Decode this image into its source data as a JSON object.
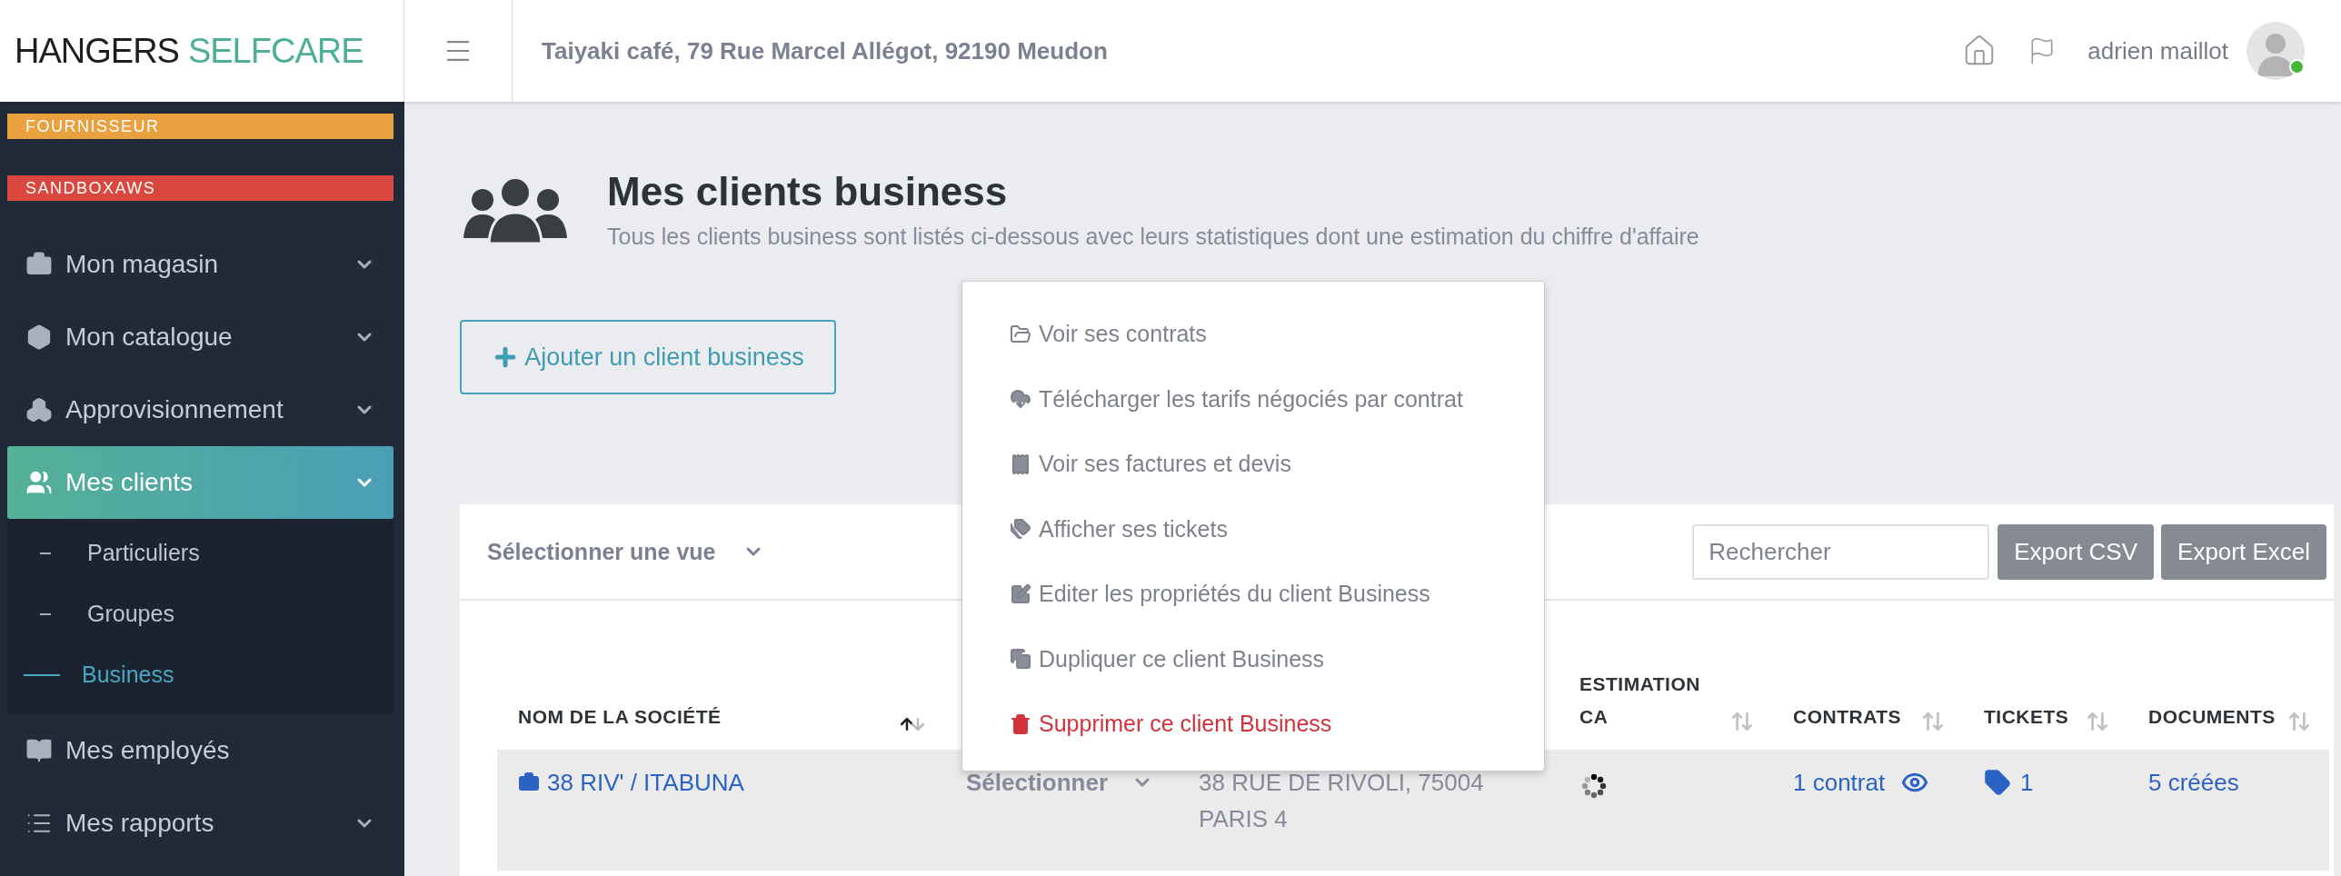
{
  "header": {
    "logo": {
      "dark": "HANGERS",
      "accent": "SELFCARE"
    },
    "address": "Taiyaki café, 79 Rue Marcel Allégot, 92190 Meudon",
    "user": {
      "name": "adrien maillot",
      "online": true
    }
  },
  "sidebar": {
    "badges": [
      {
        "label": "FOURNISSEUR",
        "color": "#e9a03e"
      },
      {
        "label": "SANDBOXAWS",
        "color": "#d9473e"
      }
    ],
    "items": [
      {
        "label": "Mon magasin",
        "kind": "group",
        "selected": false
      },
      {
        "label": "Mon catalogue",
        "kind": "group",
        "selected": false
      },
      {
        "label": "Approvisionnement",
        "kind": "group",
        "selected": false
      },
      {
        "label": "Mes clients",
        "kind": "group",
        "selected": true,
        "expanded": true,
        "children": [
          {
            "label": "Particuliers",
            "selected": false
          },
          {
            "label": "Groupes",
            "selected": false
          },
          {
            "label": "Business",
            "selected": true
          }
        ]
      },
      {
        "label": "Mes employés",
        "kind": "link",
        "selected": false
      },
      {
        "label": "Mes rapports",
        "kind": "group",
        "selected": false
      }
    ]
  },
  "page": {
    "title": "Mes clients business",
    "subtitle": "Tous les clients business sont listés ci-dessous avec leurs statistiques dont une estimation du chiffre d'affaire",
    "add_button": "Ajouter un client business"
  },
  "toolbar": {
    "view_select": "Sélectionner une vue",
    "search": {
      "placeholder": "Rechercher"
    },
    "buttons": [
      "Export CSV",
      "Export Excel"
    ]
  },
  "table": {
    "columns": [
      {
        "label": "NOM DE LA SOCIÉTÉ",
        "sorted": true
      },
      {},
      {},
      {
        "label": "ESTIMATION CA",
        "sorted": false
      },
      {
        "label": "CONTRATS",
        "sorted": false
      },
      {
        "label": "TICKETS",
        "sorted": false
      },
      {
        "label": "DOCUMENTS",
        "sorted": false
      }
    ],
    "rows": [
      {
        "name": "38 RIV' / ITABUNA",
        "action": "Sélectionner",
        "address": "38 RUE DE RIVOLI, 75004 PARIS 4",
        "estimation_loading": true,
        "contracts": "1 contrat",
        "tickets": "1",
        "documents": "5 créées",
        "selected": true
      }
    ]
  },
  "context_menu": [
    {
      "label": "Voir ses contrats",
      "kind": "normal"
    },
    {
      "label": "Télécharger les tarifs négociés par contrat",
      "kind": "normal"
    },
    {
      "label": "Voir ses factures et devis",
      "kind": "normal"
    },
    {
      "label": "Afficher ses tickets",
      "kind": "normal"
    },
    {
      "label": "Editer les propriétés du client Business",
      "kind": "normal"
    },
    {
      "label": "Dupliquer ce client Business",
      "kind": "normal"
    },
    {
      "label": "Supprimer ce client Business",
      "kind": "danger"
    }
  ]
}
